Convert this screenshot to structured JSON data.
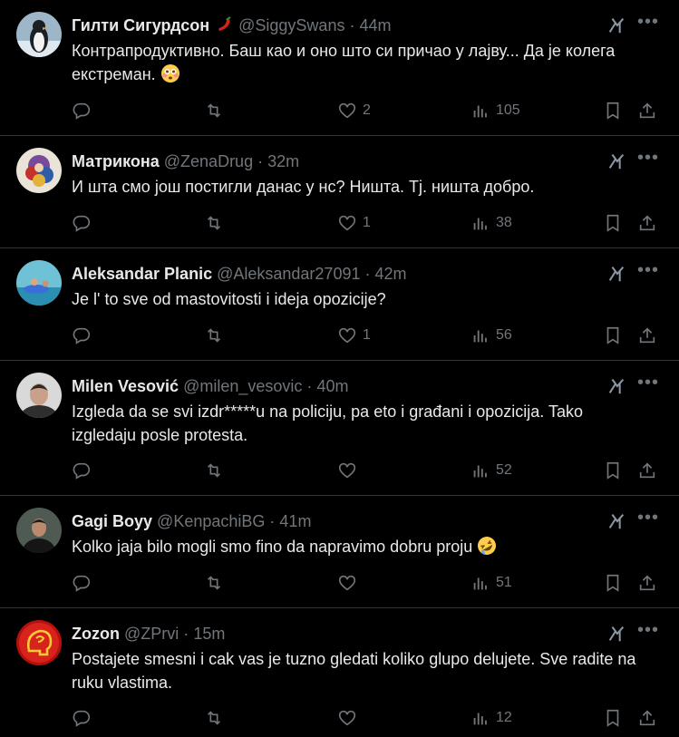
{
  "tweets": [
    {
      "name": "Гилти Сигурдсон",
      "handle": "@SiggySwans",
      "time": "44m",
      "text": "Контрапродуктивно. Баш као и оно што си причао у лајву... Да је колега екстреман.",
      "emoji": "flushed-face",
      "name_emoji": "hot-pepper",
      "likes": "2",
      "views": "105",
      "avatar": "penguin"
    },
    {
      "name": "Матрикона",
      "handle": "@ZenaDrug",
      "time": "32m",
      "text": "И шта смо још постигли данас у нс? Ништа. Тј. ништа добро.",
      "likes": "1",
      "views": "38",
      "avatar": "illustration"
    },
    {
      "name": "Aleksandar Planic",
      "handle": "@Aleksandar27091",
      "time": "42m",
      "text": "Je l' to sve od mastovitosti i ideja opozicije?",
      "likes": "1",
      "views": "56",
      "avatar": "pool"
    },
    {
      "name": "Milen Vesović",
      "handle": "@milen_vesovic",
      "time": "40m",
      "text": "Izgleda da se svi izdr*****u na policiju, pa eto i građani i opozicija. Tako izgledaju posle protesta.",
      "likes": "",
      "views": "52",
      "avatar": "portrait"
    },
    {
      "name": "Gagi Boyy",
      "handle": "@KenpachiBG",
      "time": "41m",
      "text": "Kolko jaja bilo mogli smo fino da napravimo dobru proju",
      "emoji": "rolling-laughing-face",
      "likes": "",
      "views": "51",
      "avatar": "person-dark"
    },
    {
      "name": "Zozon",
      "handle": "@ZPrvi",
      "time": "15m",
      "text": "Postajete smesni i cak vas je tuzno gledati koliko glupo delujete. Sve radite na ruku vlastima.",
      "likes": "",
      "views": "12",
      "avatar": "red-head-logo"
    }
  ],
  "icons": {
    "reply": "reply-icon",
    "retweet": "retweet-icon",
    "like": "like-icon",
    "views": "views-icon",
    "bookmark": "bookmark-icon",
    "share": "share-icon",
    "grok": "grok-icon",
    "more": "more-icon"
  },
  "colors": {
    "background": "#000000",
    "text": "#e7e9ea",
    "muted": "#71767b",
    "divider": "#2f3336"
  }
}
